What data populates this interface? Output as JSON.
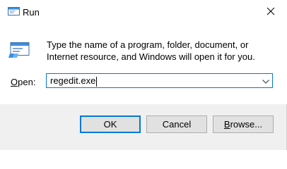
{
  "window": {
    "title": "Run",
    "close_icon": "close-icon"
  },
  "dialog": {
    "description": "Type the name of a program, folder, document, or Internet resource, and Windows will open it for you.",
    "open_label_prefix": "",
    "open_label_accel": "O",
    "open_label_rest": "pen:",
    "open_value": "regedit.exe",
    "dropdown_icon": "chevron-down-icon",
    "run_icon": "run-app-icon"
  },
  "buttons": {
    "ok": "OK",
    "cancel": "Cancel",
    "browse_accel": "B",
    "browse_rest": "rowse..."
  },
  "colors": {
    "accent": "#0078d7",
    "footer_bg": "#f0f0f0",
    "button_bg": "#e1e1e1"
  }
}
